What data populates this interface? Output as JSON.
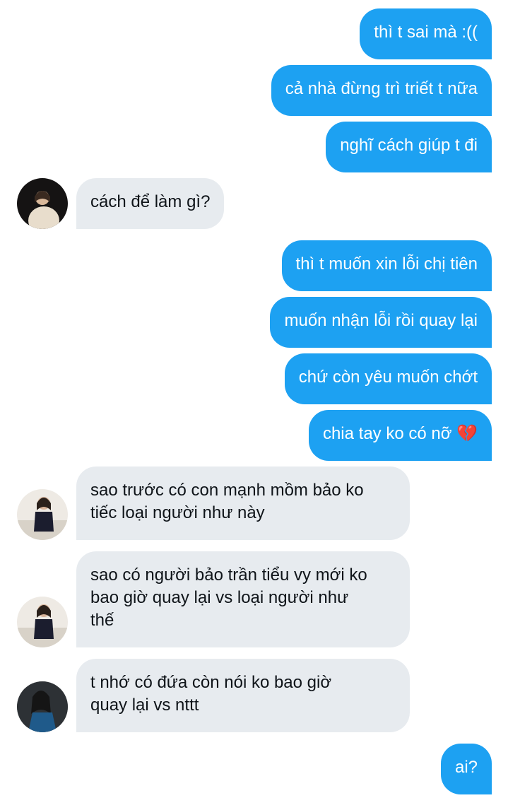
{
  "messages": [
    {
      "from": "me",
      "text": "thì t sai mà :(("
    },
    {
      "from": "me",
      "text": "cả nhà đừng trì triết t nữa"
    },
    {
      "from": "me",
      "text": "nghĩ cách giúp t đi"
    },
    {
      "from": "them",
      "text": "cách để làm gì?"
    },
    {
      "from": "me",
      "text": "thì t muốn xin lỗi chị tiên"
    },
    {
      "from": "me",
      "text": "muốn nhận lỗi rồi quay lại"
    },
    {
      "from": "me",
      "text": "chứ còn yêu muốn chớt"
    },
    {
      "from": "me",
      "text": "chia tay ko có nỡ 💔"
    },
    {
      "from": "them",
      "text": "sao trước có con mạnh mồm bảo ko\ntiếc loại người như này"
    },
    {
      "from": "them",
      "text": "sao có người bảo trần tiểu vy mới ko\nbao giờ quay lại vs loại người như\nthế"
    },
    {
      "from": "them",
      "text": "t nhớ có đứa còn nói ko bao giờ\nquay lại vs nttt"
    },
    {
      "from": "me",
      "text": "ai?"
    }
  ],
  "colors": {
    "sent_bubble": "#1da1f2",
    "received_bubble": "#e7ebef",
    "sent_text": "#ffffff",
    "received_text": "#0f1419"
  }
}
